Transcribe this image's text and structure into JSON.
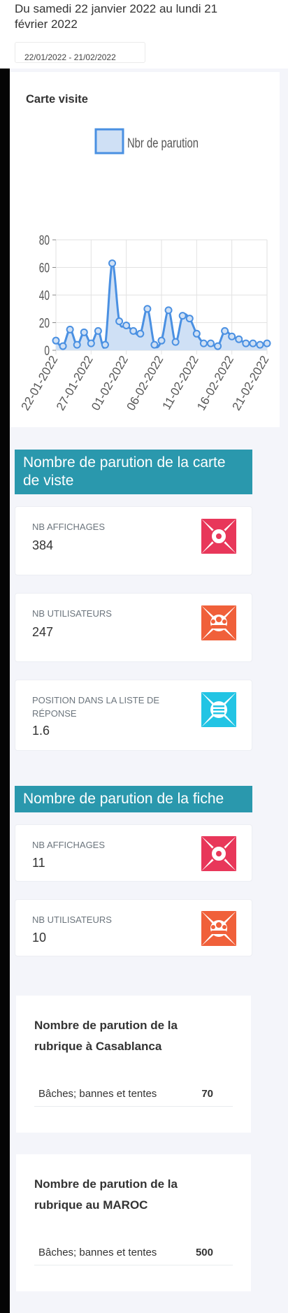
{
  "header": {
    "date_range_text": "Du samedi 22 janvier 2022 au lundi 21 février 2022",
    "date_input_value": "22/01/2022 - 21/02/2022"
  },
  "chart_card": {
    "title": "Carte visite"
  },
  "chart_data": {
    "type": "area",
    "title": "",
    "legend": [
      "Nbr de parution"
    ],
    "legend_position": "top",
    "xlabel": "",
    "ylabel": "",
    "ylim": [
      0,
      80
    ],
    "yticks": [
      0,
      20,
      40,
      60,
      80
    ],
    "grid": true,
    "x_tick_labels": [
      "22-01-2022",
      "27-01-2022",
      "01-02-2022",
      "06-02-2022",
      "11-02-2022",
      "16-02-2022",
      "21-02-2022"
    ],
    "series": [
      {
        "name": "Nbr de parution",
        "color": "#4a90e2",
        "fill": "#cfe0f5",
        "x": [
          "22-01-2022",
          "23-01-2022",
          "24-01-2022",
          "25-01-2022",
          "26-01-2022",
          "27-01-2022",
          "28-01-2022",
          "29-01-2022",
          "30-01-2022",
          "31-01-2022",
          "01-02-2022",
          "02-02-2022",
          "03-02-2022",
          "04-02-2022",
          "05-02-2022",
          "06-02-2022",
          "07-02-2022",
          "08-02-2022",
          "09-02-2022",
          "10-02-2022",
          "11-02-2022",
          "12-02-2022",
          "13-02-2022",
          "14-02-2022",
          "15-02-2022",
          "16-02-2022",
          "17-02-2022",
          "18-02-2022",
          "19-02-2022",
          "20-02-2022",
          "21-02-2022"
        ],
        "values": [
          7,
          3,
          15,
          4,
          13,
          5,
          14,
          4,
          63,
          21,
          18,
          14,
          12,
          30,
          4,
          7,
          29,
          6,
          25,
          23,
          12,
          5,
          5,
          3,
          14,
          10,
          8,
          5,
          5,
          4,
          5
        ]
      }
    ]
  },
  "section_carte": {
    "title": "Nombre de parution de la carte de viste",
    "stats": [
      {
        "label": "NB AFFICHAGES",
        "value": "384",
        "icon": "eye-icon",
        "color": "#e8375a"
      },
      {
        "label": "NB UTILISATEURS",
        "value": "247",
        "icon": "users-icon",
        "color": "#f0603a"
      },
      {
        "label": "POSITION DANS LA LISTE DE RÉPONSE",
        "value": "1.6",
        "icon": "list-icon",
        "color": "#22c4e4"
      }
    ]
  },
  "section_fiche": {
    "title": "Nombre de parution de la fiche",
    "stats": [
      {
        "label": "NB AFFICHAGES",
        "value": "11",
        "icon": "eye-icon",
        "color": "#e8375a"
      },
      {
        "label": "NB UTILISATEURS",
        "value": "10",
        "icon": "users-icon",
        "color": "#f0603a"
      }
    ]
  },
  "rubrique_casablanca": {
    "title": "Nombre de parution de la rubrique à Casablanca",
    "row": {
      "name": "Bâches; bannes et tentes",
      "count": "70"
    }
  },
  "rubrique_maroc": {
    "title": "Nombre de parution de la rubrique au MAROC",
    "row": {
      "name": "Bâches; bannes et tentes",
      "count": "500"
    }
  }
}
